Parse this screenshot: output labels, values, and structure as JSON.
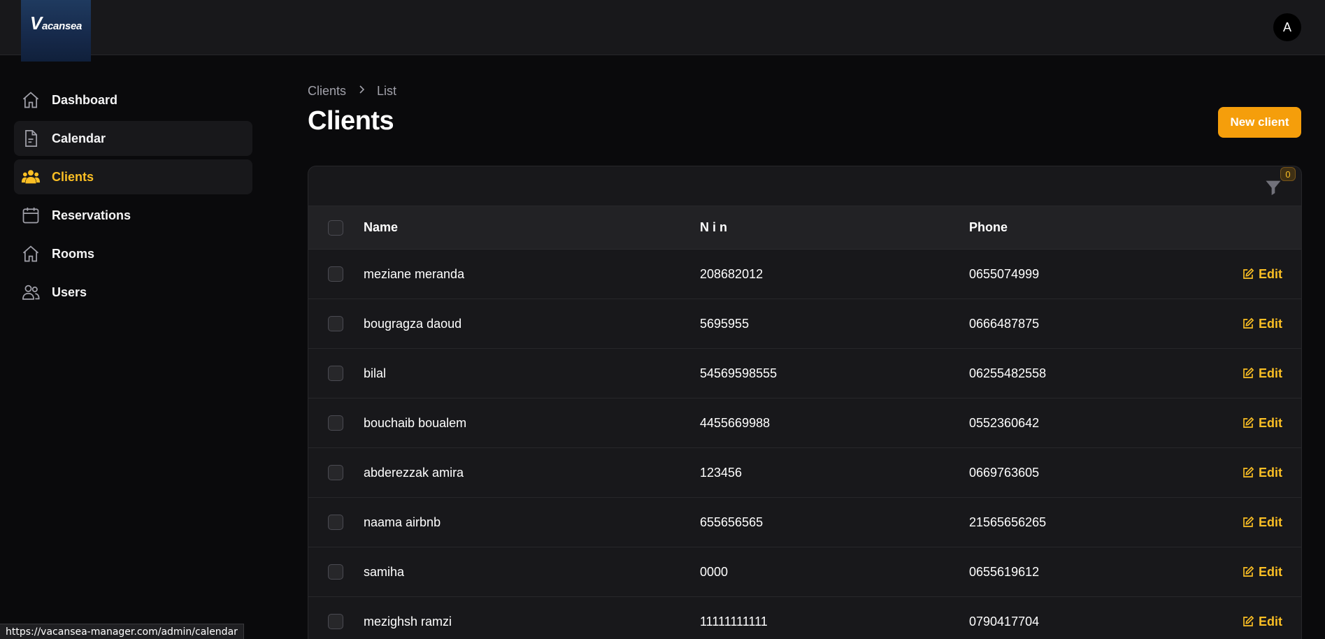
{
  "brand": {
    "logo_text_big": "V",
    "logo_text_rest": "acansea"
  },
  "user": {
    "avatar_initial": "A"
  },
  "sidebar": {
    "items": [
      {
        "label": "Dashboard",
        "icon": "home-icon"
      },
      {
        "label": "Calendar",
        "icon": "document-icon"
      },
      {
        "label": "Clients",
        "icon": "users-group-icon"
      },
      {
        "label": "Reservations",
        "icon": "calendar-icon"
      },
      {
        "label": "Rooms",
        "icon": "home-icon"
      },
      {
        "label": "Users",
        "icon": "users-icon"
      }
    ],
    "active_color": "#fbbf24"
  },
  "breadcrumb": {
    "parent": "Clients",
    "current": "List"
  },
  "page": {
    "title": "Clients",
    "new_button_label": "New client"
  },
  "filter": {
    "badge_count": "0"
  },
  "table": {
    "columns": {
      "name": "Name",
      "nin": "N i n",
      "phone": "Phone"
    },
    "action_label": "Edit",
    "rows": [
      {
        "name": "meziane meranda",
        "nin": "208682012",
        "phone": "0655074999"
      },
      {
        "name": "bougragza daoud",
        "nin": "5695955",
        "phone": "0666487875"
      },
      {
        "name": "bilal",
        "nin": "54569598555",
        "phone": "06255482558"
      },
      {
        "name": "bouchaib boualem",
        "nin": "4455669988",
        "phone": "0552360642"
      },
      {
        "name": "abderezzak amira",
        "nin": "123456",
        "phone": "0669763605"
      },
      {
        "name": "naama airbnb",
        "nin": "655656565",
        "phone": "21565656265"
      },
      {
        "name": "samiha",
        "nin": "0000",
        "phone": "0655619612"
      },
      {
        "name": "mezighsh ramzi",
        "nin": "11111111111",
        "phone": "0790417704"
      }
    ]
  },
  "status_url": "https://vacansea-manager.com/admin/calendar",
  "colors": {
    "accent": "#f59e0b",
    "accent_text": "#fbbf24",
    "background": "#0a0a0c",
    "surface": "#18181b"
  }
}
